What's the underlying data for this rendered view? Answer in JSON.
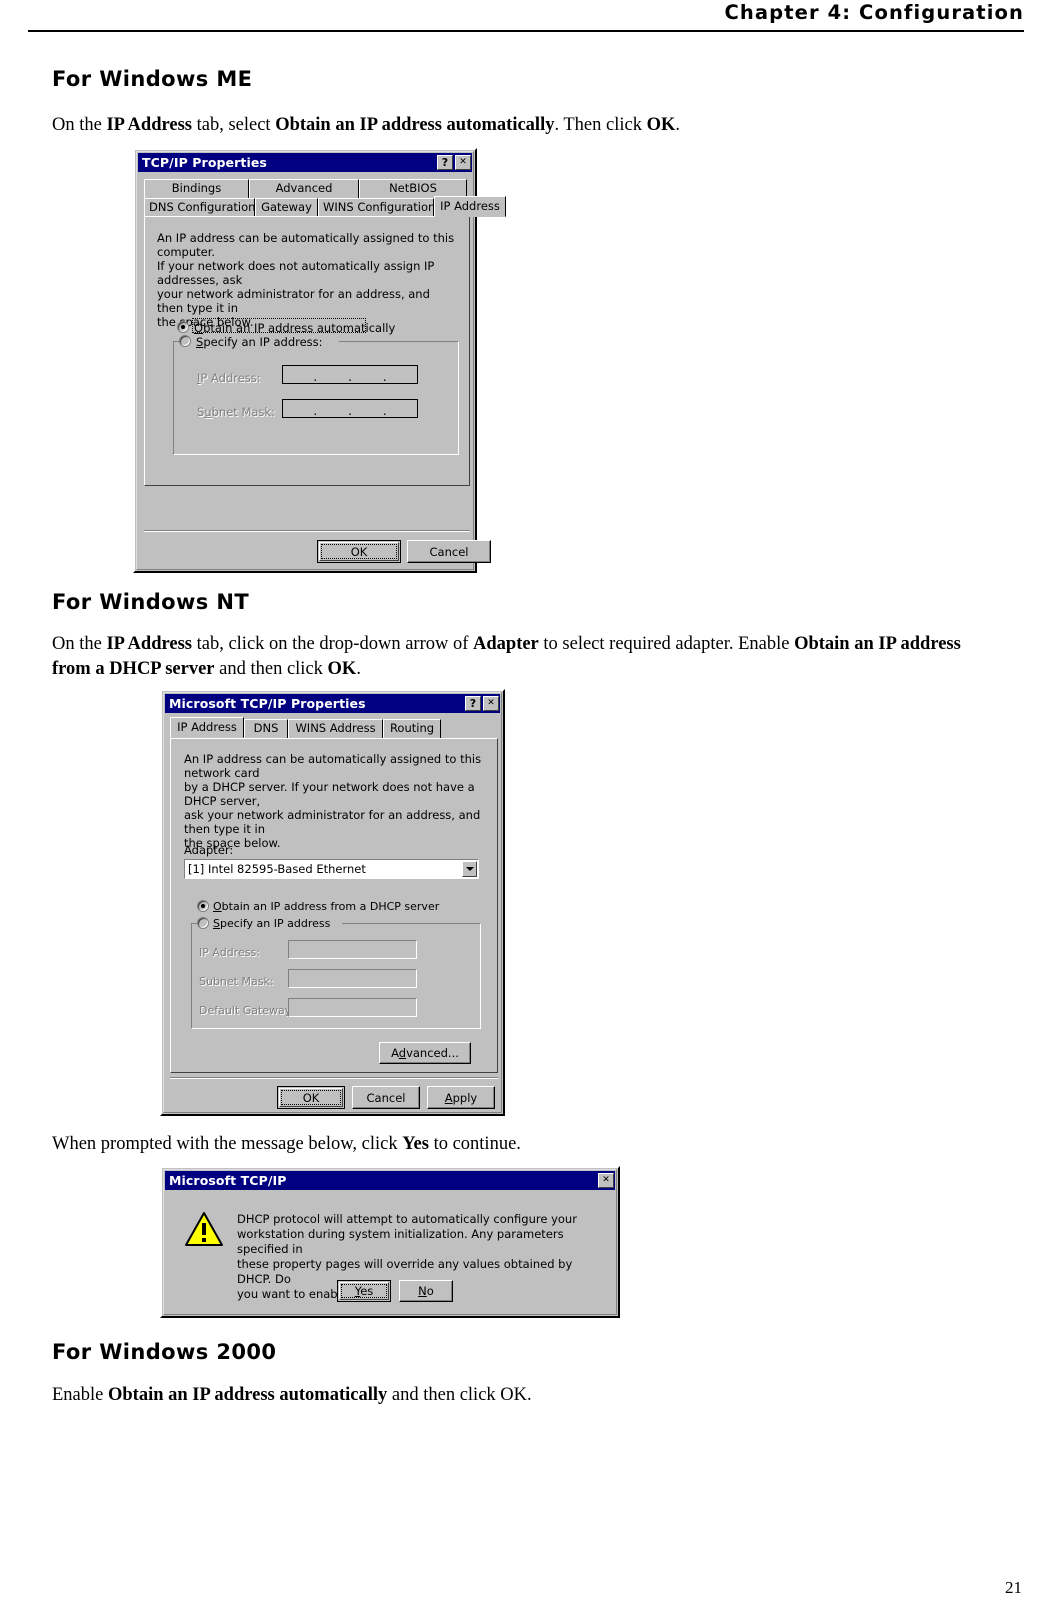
{
  "page": {
    "header_title": "Chapter 4:  Configuration",
    "page_number": "21"
  },
  "sections": {
    "me": {
      "heading": "For Windows ME",
      "instruction_parts": [
        {
          "t": "On the ",
          "b": false
        },
        {
          "t": "IP Address",
          "b": true
        },
        {
          "t": " tab, select ",
          "b": false
        },
        {
          "t": "Obtain an IP address automatically",
          "b": true
        },
        {
          "t": ". Then click ",
          "b": false
        },
        {
          "t": "OK",
          "b": true
        },
        {
          "t": ".",
          "b": false
        }
      ]
    },
    "nt": {
      "heading": "For Windows NT",
      "instruction_parts": [
        {
          "t": "On the ",
          "b": false
        },
        {
          "t": "IP Address",
          "b": true
        },
        {
          "t": " tab, click on the drop-down arrow of ",
          "b": false
        },
        {
          "t": "Adapter",
          "b": true
        },
        {
          "t": " to select required adapter. Enable ",
          "b": false
        },
        {
          "t": "Obtain an IP address from a DHCP server",
          "b": true
        },
        {
          "t": " and then click ",
          "b": false
        },
        {
          "t": "OK",
          "b": true
        },
        {
          "t": ".",
          "b": false
        }
      ],
      "prompt_parts": [
        {
          "t": "When prompted with the message below, click ",
          "b": false
        },
        {
          "t": "Yes",
          "b": true
        },
        {
          "t": " to continue.",
          "b": false
        }
      ]
    },
    "win2000": {
      "heading": "For Windows 2000",
      "instruction_parts": [
        {
          "t": "Enable ",
          "b": false
        },
        {
          "t": "Obtain an IP address automatically",
          "b": true
        },
        {
          "t": " and then click OK.",
          "b": false
        }
      ]
    }
  },
  "dialog_me": {
    "title": "TCP/IP Properties",
    "titlebar_help": "?",
    "titlebar_close": "✕",
    "tabs_row1": [
      "Bindings",
      "Advanced",
      "NetBIOS"
    ],
    "tabs_row2": [
      "DNS Configuration",
      "Gateway",
      "WINS Configuration",
      "IP Address"
    ],
    "active_tab": "IP Address",
    "description": "An IP address can be automatically assigned to this computer.\nIf your network does not automatically assign IP addresses, ask\nyour network administrator for an address, and then type it in\nthe space below.",
    "radio_auto": "Obtain an IP address automatically",
    "radio_specify": "Specify an IP address:",
    "label_ip": "IP Address:",
    "label_subnet": "Subnet Mask:",
    "btn_ok": "OK",
    "btn_cancel": "Cancel"
  },
  "dialog_nt": {
    "title": "Microsoft TCP/IP Properties",
    "titlebar_help": "?",
    "titlebar_close": "✕",
    "tabs": [
      "IP Address",
      "DNS",
      "WINS Address",
      "Routing"
    ],
    "active_tab": "IP Address",
    "description": "An IP address can be automatically assigned to this network card\nby a DHCP server.  If your network does not have a DHCP server,\nask your network administrator for an address, and then type it in\nthe space below.",
    "adapter_label": "Adapter:",
    "adapter_value": "[1] Intel 82595-Based Ethernet",
    "radio_dhcp": "Obtain an IP address from a DHCP server",
    "radio_specify": "Specify an IP address",
    "label_ip": "IP Address:",
    "label_subnet": "Subnet Mask:",
    "label_gateway": "Default Gateway:",
    "btn_advanced": "Advanced...",
    "btn_ok": "OK",
    "btn_cancel": "Cancel",
    "btn_apply": "Apply"
  },
  "dialog_msg": {
    "title": "Microsoft TCP/IP",
    "titlebar_close": "✕",
    "icon": "warning-triangle",
    "message": "DHCP protocol will attempt to automatically configure your\nworkstation during system initialization. Any parameters specified in\nthese property pages will override any values obtained by DHCP. Do\nyou want to enable DHCP?",
    "btn_yes": "Yes",
    "btn_no": "No"
  },
  "colors": {
    "titlebar": "#000080",
    "dialog_face": "#c0c0c0",
    "warning_yellow": "#ffff00",
    "text": "#000000"
  }
}
